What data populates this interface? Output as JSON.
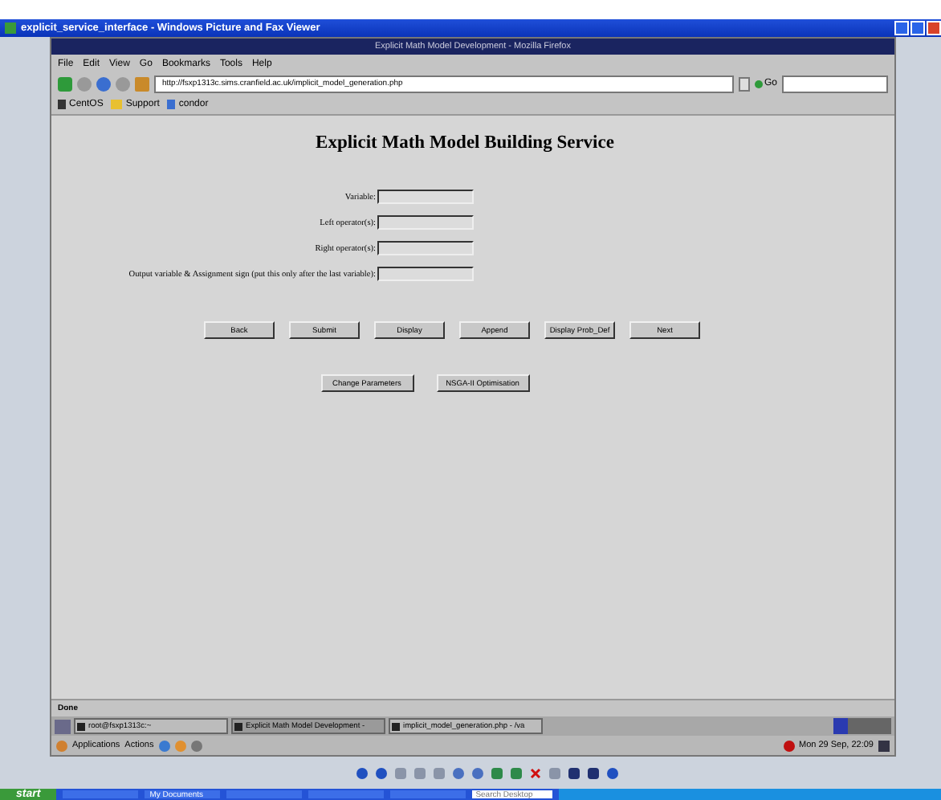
{
  "viewer": {
    "title": "explicit_service_interface - Windows Picture and Fax Viewer"
  },
  "browser": {
    "title": "Explicit Math Model Development - Mozilla Firefox",
    "menu": [
      "File",
      "Edit",
      "View",
      "Go",
      "Bookmarks",
      "Tools",
      "Help"
    ],
    "url": "http://fsxp1313c.sims.cranfield.ac.uk/implicit_model_generation.php",
    "go_label": "Go",
    "bookmarks": [
      "CentOS",
      "Support",
      "condor"
    ],
    "status": "Done"
  },
  "page": {
    "heading": "Explicit Math Model Building Service",
    "fields": [
      {
        "label": "Variable:"
      },
      {
        "label": "Left operator(s):"
      },
      {
        "label": "Right operator(s):"
      },
      {
        "label": "Output variable & Assignment sign (put this only after the last variable):"
      }
    ],
    "buttons": [
      "Back",
      "Submit",
      "Display",
      "Append",
      "Display Prob_Def",
      "Next"
    ],
    "buttons_2": [
      "Change Parameters",
      "NSGA-II Optimisation"
    ]
  },
  "panel": {
    "tasks": [
      {
        "label": "root@fsxp1313c:~",
        "selected": false
      },
      {
        "label": "Explicit Math Model Development -",
        "selected": true
      },
      {
        "label": "implicit_model_generation.php - /va",
        "selected": false
      }
    ],
    "menus": [
      "Applications",
      "Actions"
    ],
    "clock": "Mon 29 Sep, 22:09"
  },
  "taskbar": {
    "start": "start",
    "items": [
      "My Documents"
    ],
    "search_placeholder": "Search Desktop"
  }
}
